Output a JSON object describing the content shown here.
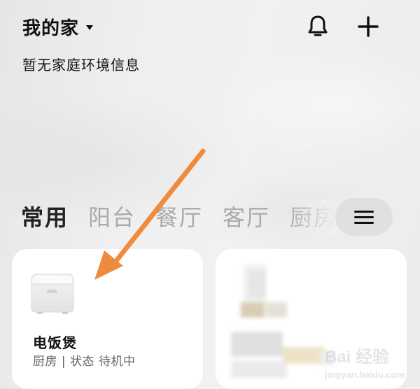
{
  "header": {
    "home_name": "我的家",
    "environment_info": "暂无家庭环境信息"
  },
  "icons": {
    "home_dropdown": "caret-down-icon",
    "notifications": "bell-icon",
    "add": "plus-icon",
    "room_menu": "menu-icon"
  },
  "rooms": {
    "tabs": [
      "常用",
      "阳台",
      "餐厅",
      "客厅",
      "厨房"
    ],
    "active_index": 0
  },
  "devices": [
    {
      "name": "电饭煲",
      "status": "厨房 | 状态 待机中",
      "icon": "rice-cooker-icon"
    },
    {
      "name": "",
      "status": "",
      "icon": "blurred-device"
    }
  ],
  "annotation": {
    "arrow_color": "#f08a3c"
  },
  "watermark": {
    "text": "Bai 经验",
    "url": "jingyan.baidu.com"
  }
}
